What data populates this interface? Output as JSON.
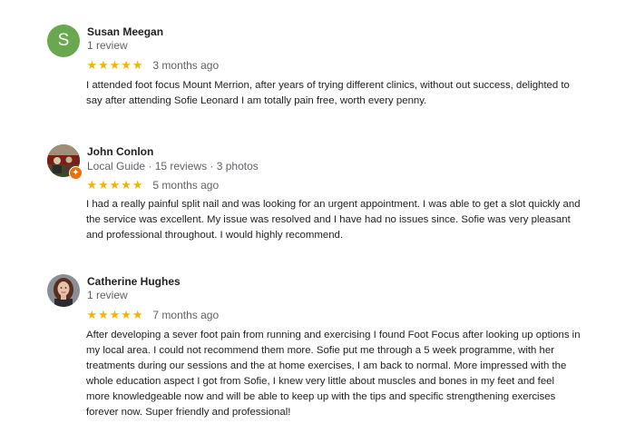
{
  "reviews": [
    {
      "name": "Susan Meegan",
      "avatar_letter": "S",
      "meta": "1 review",
      "rating": 5,
      "time": "3 months ago",
      "text": "I attended foot focus Mount Merrion, after years of trying different clinics, without out success, delighted to say after attending Sofie Leonard I am totally pain free, worth every penny."
    },
    {
      "name": "John Conlon",
      "meta": "Local Guide · 15 reviews · 3 photos",
      "rating": 5,
      "time": "5 months ago",
      "text": "I had a really painful split nail and was looking for an urgent appointment. I was able to get a slot quickly and the service was excellent. My issue was resolved and I have had no issues since. Sofie was very pleasant and professional throughout. I would highly recommend."
    },
    {
      "name": "Catherine Hughes",
      "meta": "1 review",
      "rating": 5,
      "time": "7 months ago",
      "text": "After developing a sever foot pain from running and exercising I found Foot Focus after looking up options in my local area. I could not recommend them more. Sofie put me through a 5 week programme, with her treatments during our sessions and the at home exercises, I am back to normal. More impressed with the whole education aspect I got from Sofie, I knew very little about muscles and bones in my feet and feel more knowledgeable now and will be able to keep up with the tips and specific strengthening exercises forever now. Super friendly and professional!"
    }
  ],
  "colors": {
    "star": "#f4b400",
    "avatar_s": "#6aa84f",
    "local_guide_badge": "#e8710a"
  }
}
